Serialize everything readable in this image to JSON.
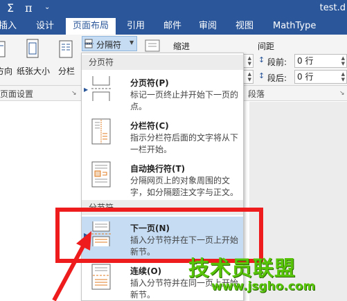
{
  "window": {
    "quick_access": [
      "Σ",
      "π",
      "⌄"
    ],
    "title": "test.d"
  },
  "tabs": [
    "插入",
    "设计",
    "页面布局",
    "引用",
    "邮件",
    "审阅",
    "视图",
    "MathType"
  ],
  "active_tab": "页面布局",
  "ribbon": {
    "orientation_label": "方向",
    "paper_size_label": "纸张大小",
    "columns_label": "分栏",
    "breaks_button": "分隔符",
    "indent_label": "缩进",
    "spacing_label": "间距",
    "spacing_before_label": "段前:",
    "spacing_before_value": "0 行",
    "spacing_after_label": "段后:",
    "spacing_after_value": "0 行",
    "group_page_setup": "页面设置",
    "group_paragraph": "段落"
  },
  "breaks_menu": {
    "page_breaks_header": "分页符",
    "section_breaks_header": "分节符",
    "items": [
      {
        "title": "分页符(P)",
        "desc": "标记一页终止并开始下一页的点。"
      },
      {
        "title": "分栏符(C)",
        "desc": "指示分栏符后面的文字将从下一栏开始。"
      },
      {
        "title": "自动换行符(T)",
        "desc": "分隔网页上的对象周围的文字，如分隔题注文字与正文。"
      },
      {
        "title": "下一页(N)",
        "desc": "插入分节符并在下一页上开始新节。"
      },
      {
        "title": "连续(O)",
        "desc": "插入分节符并在同一页上开始新节。"
      }
    ],
    "highlighted_item": "下一页(N)"
  },
  "watermark": {
    "text": "技术员联盟",
    "url": "www.jsgho.com"
  },
  "colors": {
    "ribbon_blue": "#2b579a",
    "annotation_red": "#ee1c1c",
    "watermark_green": "#57c40a",
    "highlight": "#c5dcf3"
  }
}
